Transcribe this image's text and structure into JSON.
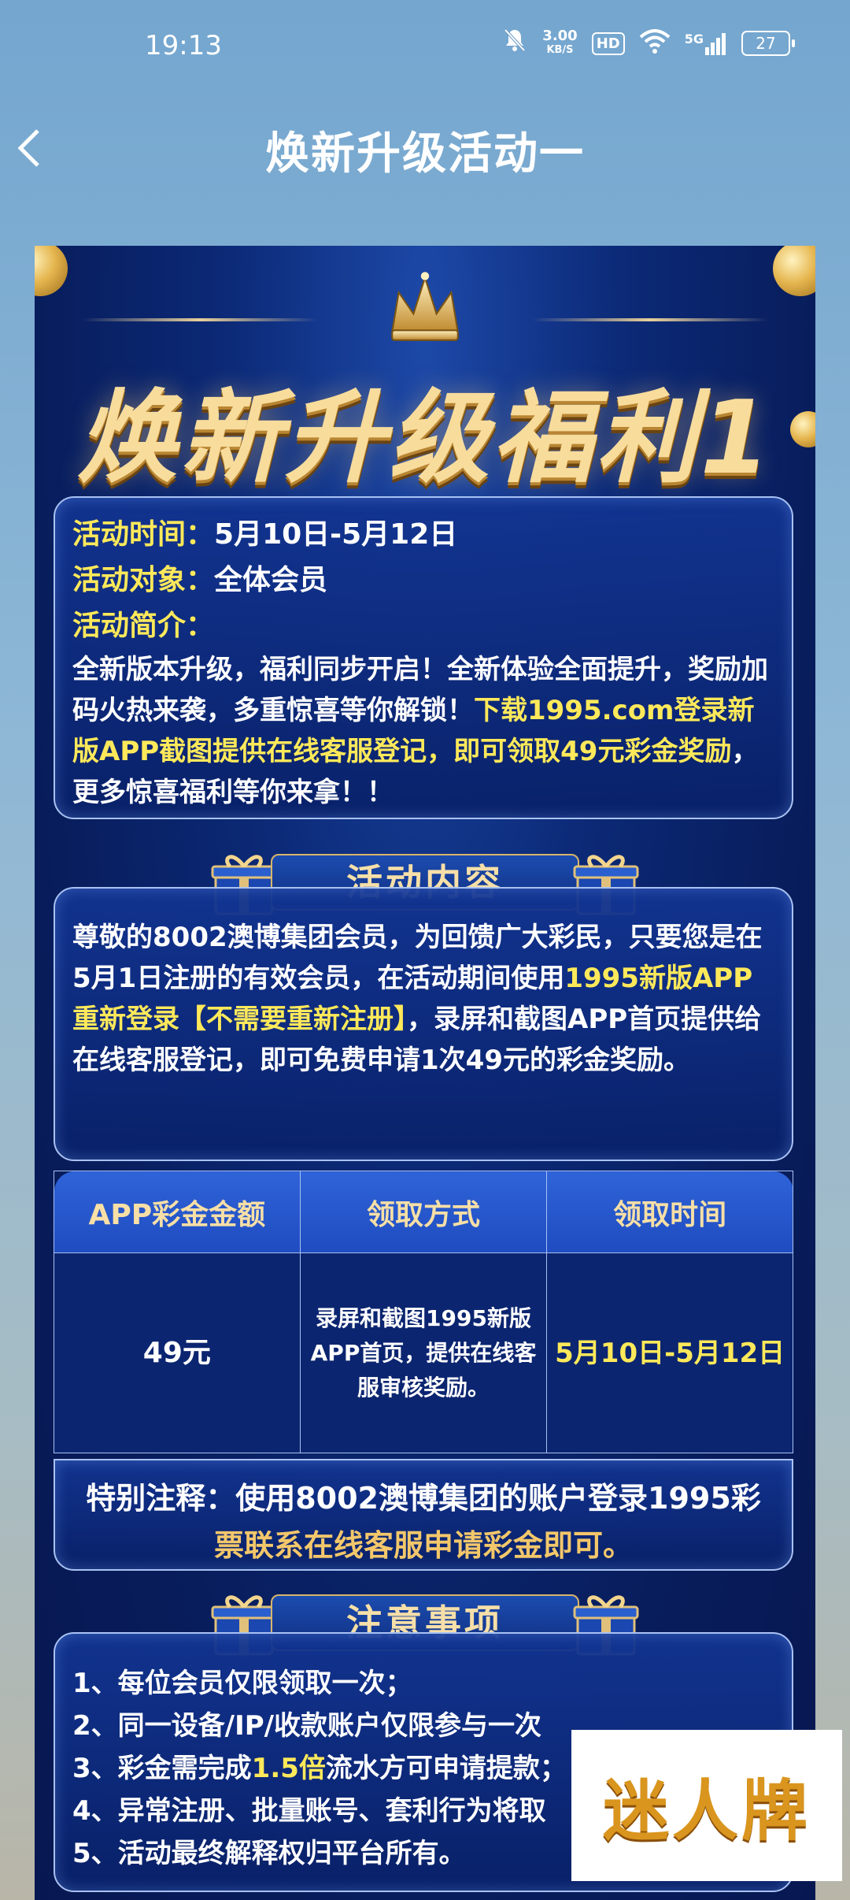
{
  "status_bar": {
    "time": "19:13",
    "net_speed": "3.00",
    "net_unit": "KB/S",
    "hd": "HD",
    "signal": "5G",
    "battery": "27"
  },
  "titlebar": {
    "title": "焕新升级活动一"
  },
  "poster": {
    "headline": "焕新升级福利1",
    "info": {
      "time_label": "活动时间：",
      "time_value": "5月10日-5月12日",
      "target_label": "活动对象：",
      "target_value": "全体会员",
      "intro_label": "活动简介：",
      "intro_plain": "全新版本升级，福利同步开启！全新体验全面提升，奖励加码火热来袭，多重惊喜等你解锁！",
      "intro_highlight": "下载1995.com登录新版APP截图提供在线客服登记，即可领取49元彩金奖励",
      "intro_tail": "，更多惊喜福利等你来拿！！"
    },
    "content_section": {
      "heading": "活动内容",
      "text_a": "尊敬的8002澳博集团会员，为回馈广大彩民，只要您是在5月1日注册的有效会员，在活动期间使用",
      "text_highlight": "1995新版APP重新登录【不需要重新注册】",
      "text_b": "，录屏和截图APP首页提供给在线客服登记，即可免费申请1次49元的彩金奖励。"
    },
    "table": {
      "headers": [
        "APP彩金金额",
        "领取方式",
        "领取时间"
      ],
      "amount": "49元",
      "method": "录屏和截图1995新版APP首页，提供在线客服审核奖励。",
      "period": "5月10日-5月12日"
    },
    "special_note": {
      "label": "特别注释：",
      "text_white": "使用8002澳博集团的账户登录1995彩",
      "text_gold": "票联系在线客服申请彩金即可。"
    },
    "notice_section": {
      "heading": "注意事项",
      "items": [
        "1、每位会员仅限领取一次；",
        "2、同一设备/IP/收款账户仅限参与一次",
        "3、彩金需完成",
        "4、异常注册、批量账号、套利行为将取",
        "5、活动最终解释权归平台所有。"
      ],
      "item3_highlight": "1.5倍",
      "item3_tail": "流水方可申请提款；"
    }
  },
  "watermark": {
    "text": "迷人牌"
  },
  "colors": {
    "accent_yellow": "#ffe95a",
    "gold": "#f3c76a",
    "poster_blue": "#0c2a78"
  }
}
